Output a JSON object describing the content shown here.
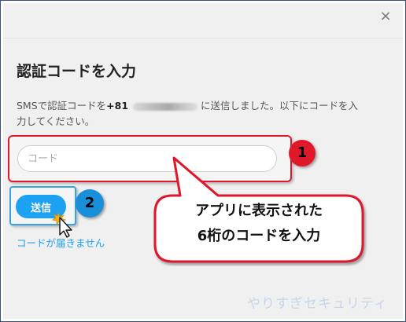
{
  "dialog": {
    "close_glyph": "×",
    "title": "認証コードを入力",
    "description_prefix": "SMSで認証コードを",
    "phone_prefix": "+81",
    "description_suffix": "に送信しました。以下にコードを入",
    "description_line2": "力してください。",
    "code_input": {
      "value": "",
      "placeholder": "コード"
    },
    "send_button": "送信",
    "resend_link": "コードが届きません"
  },
  "annotations": {
    "badge1": "1",
    "badge2": "2",
    "callout_line1": "アプリに表示された",
    "callout_line2": "6桁のコードを入力",
    "red_color": "#e0192a",
    "blue_color": "#1a8fd9"
  },
  "watermark": "やりすぎセキュリティ",
  "icons": {
    "close": "close-icon",
    "cursor": "mouse-cursor-icon",
    "click": "click-burst-icon"
  }
}
